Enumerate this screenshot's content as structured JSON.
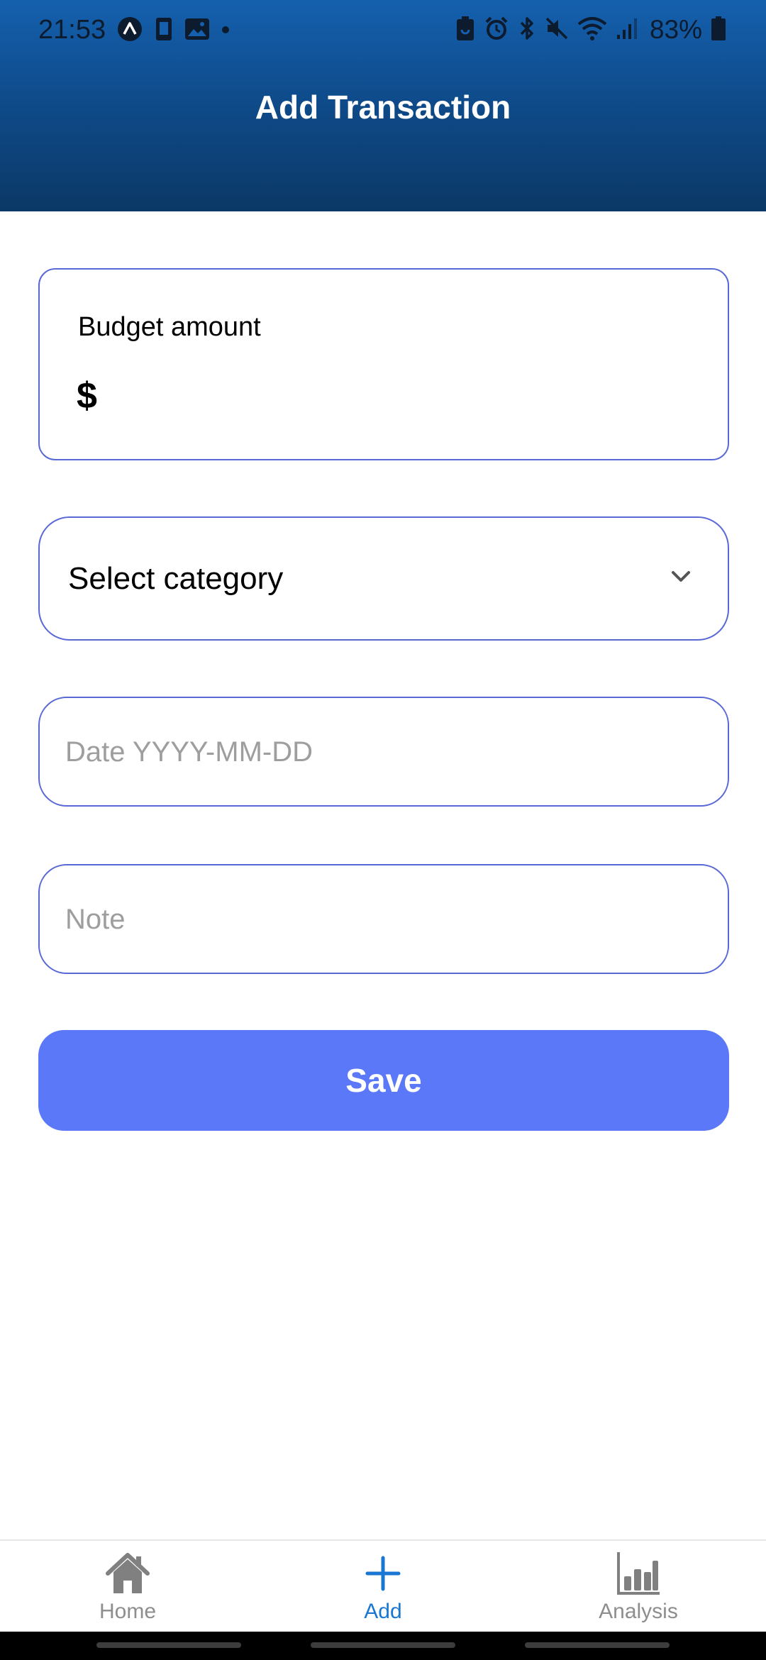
{
  "status_bar": {
    "time": "21:53",
    "battery": "83%"
  },
  "header": {
    "title": "Add Transaction"
  },
  "form": {
    "budget_label": "Budget amount",
    "currency_symbol": "$",
    "budget_value": "",
    "category_placeholder": "Select category",
    "date_placeholder": "Date YYYY-MM-DD",
    "date_value": "",
    "note_placeholder": "Note",
    "note_value": "",
    "save_label": "Save"
  },
  "nav": {
    "items": [
      {
        "label": "Home",
        "icon": "home-icon",
        "active": false
      },
      {
        "label": "Add",
        "icon": "plus-icon",
        "active": true
      },
      {
        "label": "Analysis",
        "icon": "bar-chart-icon",
        "active": false
      }
    ]
  },
  "colors": {
    "header_top": "#1560ae",
    "header_bottom": "#0b3866",
    "field_border": "#5869d6",
    "save_button": "#5b78f8",
    "nav_active": "#1976d2",
    "nav_inactive": "#8e8e8e"
  }
}
